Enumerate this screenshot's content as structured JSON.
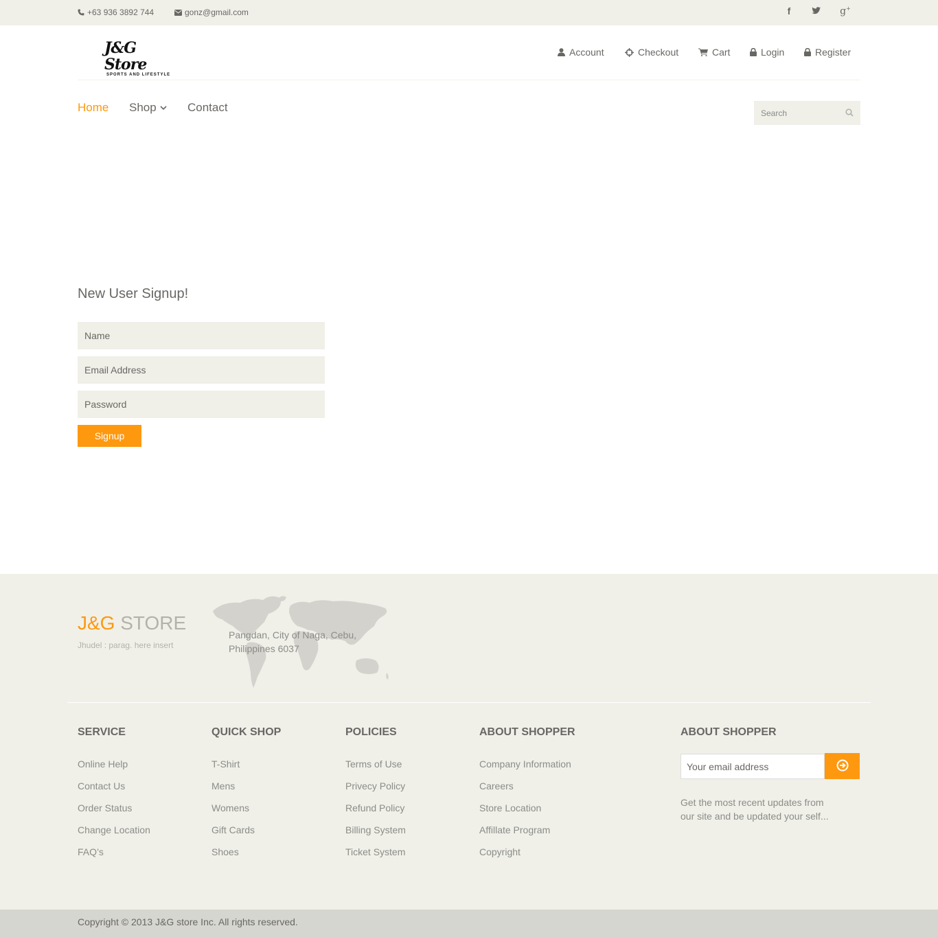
{
  "topbar": {
    "phone": "+63 936 3892 744",
    "email": "gonz@gmail.com",
    "social": [
      "facebook-icon",
      "twitter-icon",
      "google-plus-icon"
    ]
  },
  "logo": {
    "script": "J&G Store",
    "tagline": "SPORTS AND LIFESTYLE"
  },
  "usermenu": {
    "account": "Account",
    "checkout": "Checkout",
    "cart": "Cart",
    "login": "Login",
    "register": "Register"
  },
  "nav": {
    "home": "Home",
    "shop": "Shop",
    "contact": "Contact"
  },
  "search": {
    "placeholder": "Search"
  },
  "signup": {
    "title": "New User Signup!",
    "name_placeholder": "Name",
    "email_placeholder": "Email Address",
    "password_placeholder": "Password",
    "button": "Signup"
  },
  "footer": {
    "brand_a": "J&G",
    "brand_b": " STORE",
    "brand_sub": "Jhudel : parag. here insert",
    "address_line1": "Pangdan, City of Naga, Cebu,",
    "address_line2": "Philippines 6037",
    "columns": [
      {
        "heading": "SERVICE",
        "items": [
          "Online Help",
          "Contact Us",
          "Order Status",
          "Change Location",
          "FAQ’s"
        ]
      },
      {
        "heading": "QUICK SHOP",
        "items": [
          "T-Shirt",
          "Mens",
          "Womens",
          "Gift Cards",
          "Shoes"
        ]
      },
      {
        "heading": "POLICIES",
        "items": [
          "Terms of Use",
          "Privecy Policy",
          "Refund Policy",
          "Billing System",
          "Ticket System"
        ]
      },
      {
        "heading": "ABOUT SHOPPER",
        "items": [
          "Company Information",
          "Careers",
          "Store Location",
          "Affillate Program",
          "Copyright"
        ]
      }
    ],
    "subscribe": {
      "heading": "ABOUT SHOPPER",
      "placeholder": "Your email address",
      "text": "Get the most recent updates from our site and be updated your self..."
    },
    "copyright": "Copyright © 2013 J&G store Inc. All rights reserved."
  },
  "colors": {
    "accent": "#fe980f",
    "panel": "#f0f0e9",
    "text": "#696763"
  }
}
